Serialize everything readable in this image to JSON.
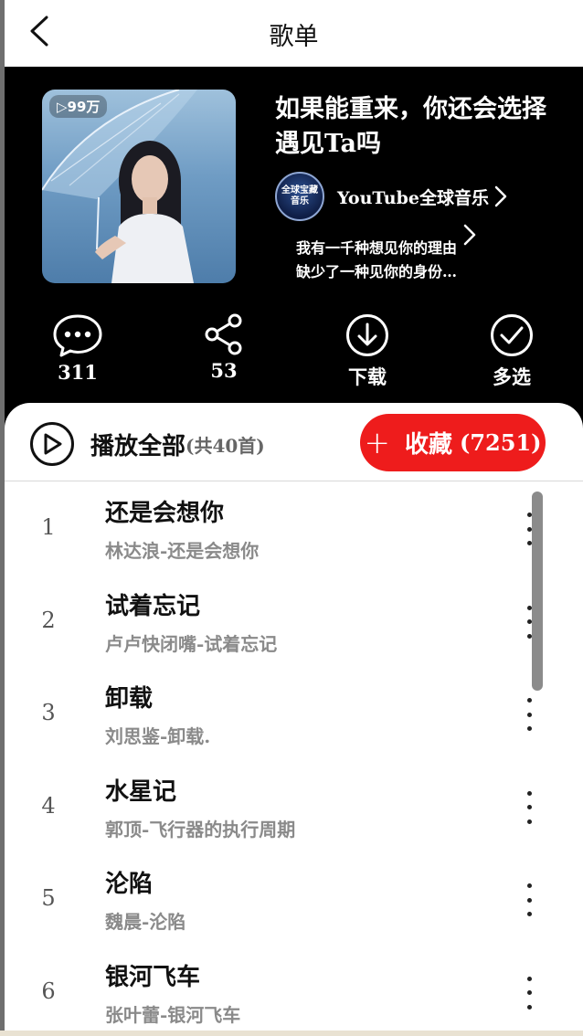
{
  "header": {
    "title": "歌单"
  },
  "playlist": {
    "play_count": "▷99万",
    "title": "如果能重来，你还会选择遇见Ta吗",
    "creator": {
      "name": "YouTube全球音乐",
      "avatar_text_line1": "全球宝藏",
      "avatar_text_line2": "音乐"
    },
    "description_line1": "我有一千种想见你的理由",
    "description_line2": "缺少了一种见你的身份…"
  },
  "actions": {
    "comment_count": "311",
    "share_count": "53",
    "download_label": "下载",
    "multiselect_label": "多选"
  },
  "toolbar": {
    "play_all_label": "播放全部",
    "play_all_count": "(共40首)",
    "collect_label": "收藏",
    "collect_count": "(7251)"
  },
  "songs": [
    {
      "index": "1",
      "title": "还是会想你",
      "subtitle": "林达浪-还是会想你"
    },
    {
      "index": "2",
      "title": "试着忘记",
      "subtitle": "卢卢快闭嘴-试着忘记"
    },
    {
      "index": "3",
      "title": "卸载",
      "subtitle": "刘思鉴-卸载."
    },
    {
      "index": "4",
      "title": "水星记",
      "subtitle": "郭顶-飞行器的执行周期"
    },
    {
      "index": "5",
      "title": "沦陷",
      "subtitle": "魏晨-沦陷"
    },
    {
      "index": "6",
      "title": "银河飞车",
      "subtitle": "张叶蕾-银河飞车"
    }
  ],
  "colors": {
    "accent": "#ee1c1c",
    "hero_bg": "#000000",
    "muted_text": "#8a8a8a"
  },
  "icons": {
    "back": "chevron-left-icon",
    "comment": "comment-bubble-icon",
    "share": "share-icon",
    "download": "download-circle-icon",
    "multiselect": "check-circle-icon",
    "play": "play-circle-icon",
    "more": "more-vertical-icon"
  }
}
